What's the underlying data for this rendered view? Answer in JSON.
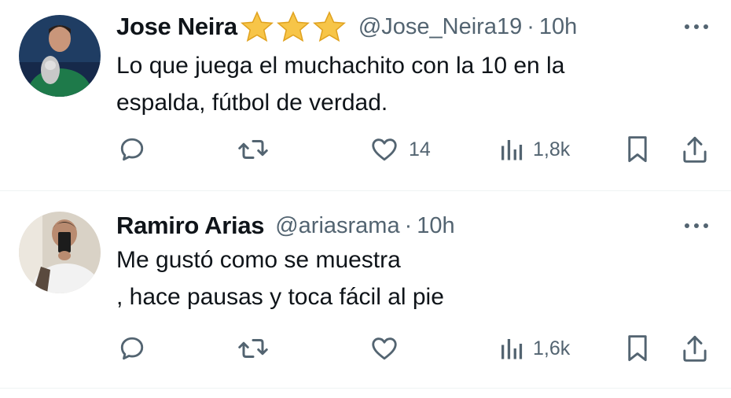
{
  "tweets": [
    {
      "display_name": "Jose Neira",
      "badge_icons": [
        "star-emoji",
        "star-emoji",
        "star-emoji"
      ],
      "handle": "@Jose_Neira19",
      "separator": "·",
      "time": "10h",
      "text_lines": [
        "Lo que juega el muchachito con la 10 en la",
        "espalda, fútbol de verdad."
      ],
      "likes": "14",
      "views": "1,8k"
    },
    {
      "display_name": "Ramiro Arias",
      "handle": "@ariasrama",
      "separator": "·",
      "time": "10h",
      "text_lines": [
        "Me gustó como se muestra",
        ", hace pausas y toca fácil al pie"
      ],
      "likes": "",
      "views": "1,6k"
    }
  ],
  "colors": {
    "text": "#0f1419",
    "secondary": "#536471",
    "divider": "#eff3f4",
    "star": "#f7c548"
  },
  "icons": [
    "reply-icon",
    "retweet-icon",
    "like-icon",
    "views-icon",
    "bookmark-icon",
    "share-icon",
    "more-icon"
  ]
}
